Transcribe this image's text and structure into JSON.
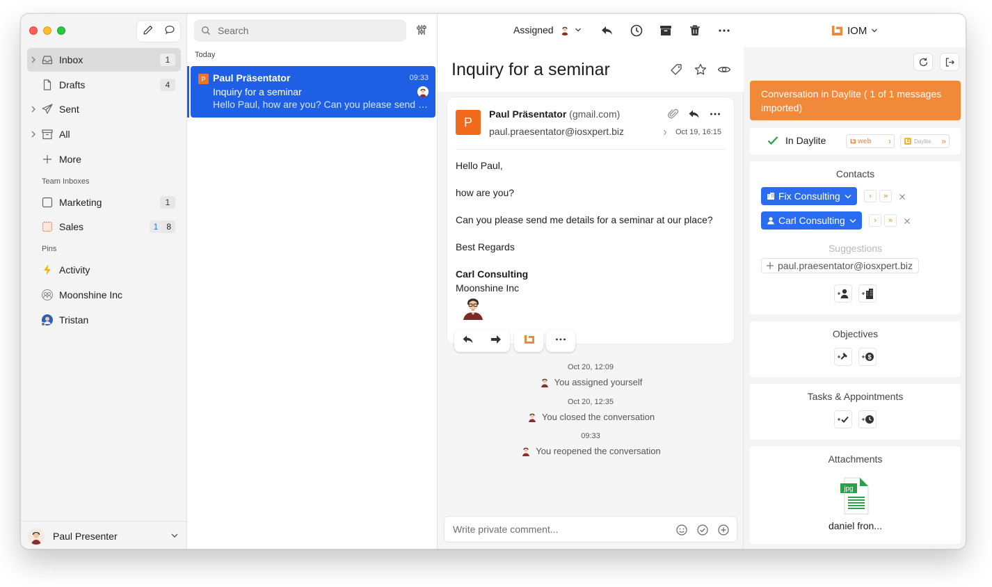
{
  "sidebar": {
    "items": [
      {
        "label": "Inbox",
        "badge": "1"
      },
      {
        "label": "Drafts",
        "badge": "4"
      },
      {
        "label": "Sent"
      },
      {
        "label": "All"
      },
      {
        "label": "More"
      }
    ],
    "team_label": "Team Inboxes",
    "team": [
      {
        "label": "Marketing",
        "badge": "1"
      },
      {
        "label": "Sales",
        "badge_unread": "1",
        "badge": "8"
      }
    ],
    "pins_label": "Pins",
    "pins": [
      {
        "label": "Activity"
      },
      {
        "label": "Moonshine Inc"
      },
      {
        "label": "Tristan"
      }
    ],
    "user": "Paul Presenter"
  },
  "list": {
    "search_placeholder": "Search",
    "section": "Today",
    "messages": [
      {
        "initial": "P",
        "from": "Paul Präsentator",
        "time": "09:33",
        "subject": "Inquiry for a seminar",
        "preview": "Hello Paul, how are you? Can you please send me details for a seminar at our place?"
      }
    ]
  },
  "toolbar": {
    "assigned_label": "Assigned",
    "account": "IOM"
  },
  "message": {
    "subject": "Inquiry for a seminar",
    "initial": "P",
    "from_name": "Paul Präsentator",
    "from_domain": "(gmail.com)",
    "from_email": "paul.praesentator@iosxpert.biz",
    "date": "Oct 19, 16:15",
    "body": [
      "Hello Paul,",
      "how are you?",
      "Can you please send me details for a seminar at our place?",
      "Best Regards"
    ],
    "signature_name": "Carl Consulting",
    "signature_company": "Moonshine Inc"
  },
  "timeline": [
    {
      "time": "Oct 20, 12:09",
      "text": "You assigned yourself"
    },
    {
      "time": "Oct 20, 12:35",
      "text": "You closed the conversation"
    },
    {
      "time": "09:33",
      "text": "You reopened the conversation"
    }
  ],
  "comment_placeholder": "Write private comment...",
  "right": {
    "banner": "Conversation in Daylite ( 1 of 1 messages imported)",
    "in_daylite": "In Daylite",
    "web_label": "web",
    "daylite_label": "Daylite",
    "contacts_title": "Contacts",
    "contacts": [
      {
        "label": "Fix Consulting",
        "kind": "company"
      },
      {
        "label": "Carl Consulting",
        "kind": "person"
      }
    ],
    "suggestions_title": "Suggestions",
    "suggestion_email": "paul.praesentator@iosxpert.biz",
    "objectives_title": "Objectives",
    "tasks_title": "Tasks & Appointments",
    "attachments_title": "Attachments",
    "attachment_ext": "jpg",
    "attachment_name": "daniel fron..."
  },
  "colors": {
    "accent": "#1f5fe6",
    "banner": "#f08a3a",
    "contact_chip": "#2a6cf0",
    "avatar_orange": "#f26a1b"
  }
}
